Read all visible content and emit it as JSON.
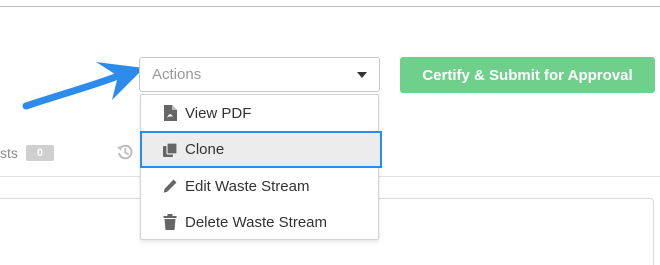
{
  "tabs": {
    "fragment_label": "sts",
    "fragment_count": "0"
  },
  "actions": {
    "placeholder": "Actions",
    "menu_items": [
      {
        "label": "View PDF",
        "icon": "file-pdf-icon"
      },
      {
        "label": "Clone",
        "icon": "clone-icon",
        "highlighted": true
      },
      {
        "label": "Edit Waste Stream",
        "icon": "pencil-icon"
      },
      {
        "label": "Delete Waste Stream",
        "icon": "trash-icon"
      }
    ]
  },
  "certify_button": {
    "label": "Certify & Submit for Approval"
  },
  "colors": {
    "primary_button": "#6fd08b",
    "focus_outline": "#2d8ceb",
    "annotation_arrow": "#2d8ceb",
    "badge": "#cfcfcf"
  }
}
